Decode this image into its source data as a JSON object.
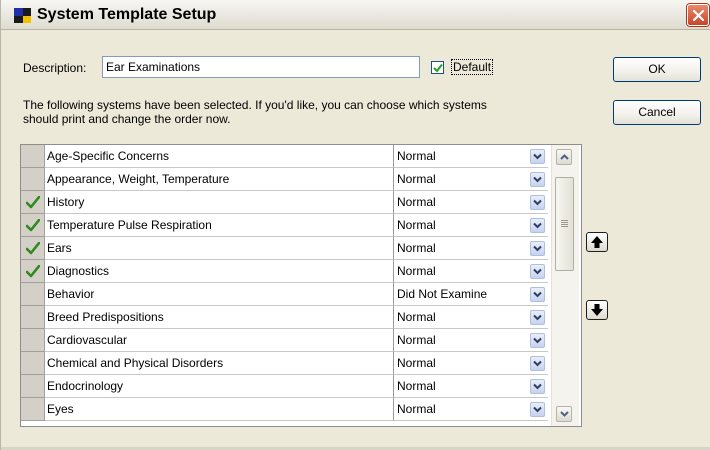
{
  "window": {
    "title": "System Template Setup"
  },
  "form": {
    "description_label": "Description:",
    "description_value": "Ear Examinations",
    "default_label": "Default",
    "default_checked": true
  },
  "buttons": {
    "ok": "OK",
    "cancel": "Cancel"
  },
  "info": {
    "line1": "The following systems have been selected.  If you'd like, you can choose which systems",
    "line2": "should print and change the order now."
  },
  "systems": [
    {
      "name": "Age-Specific Concerns",
      "status": "Normal",
      "checked": false
    },
    {
      "name": "Appearance, Weight, Temperature",
      "status": "Normal",
      "checked": false
    },
    {
      "name": "History",
      "status": "Normal",
      "checked": true
    },
    {
      "name": "Temperature Pulse Respiration",
      "status": "Normal",
      "checked": true
    },
    {
      "name": "Ears",
      "status": "Normal",
      "checked": true
    },
    {
      "name": "Diagnostics",
      "status": "Normal",
      "checked": true
    },
    {
      "name": "Behavior",
      "status": "Did Not Examine",
      "checked": false
    },
    {
      "name": "Breed Predispositions",
      "status": "Normal",
      "checked": false
    },
    {
      "name": "Cardiovascular",
      "status": "Normal",
      "checked": false
    },
    {
      "name": "Chemical and Physical Disorders",
      "status": "Normal",
      "checked": false
    },
    {
      "name": "Endocrinology",
      "status": "Normal",
      "checked": false
    },
    {
      "name": "Eyes",
      "status": "Normal",
      "checked": false
    }
  ],
  "icons": {
    "app": "app-icon",
    "close": "close-icon",
    "check": "checkmark-icon",
    "dropdown": "chevron-down-icon",
    "scroll_up": "scroll-up-icon",
    "scroll_down": "scroll-down-icon",
    "move_up": "move-up-arrow-icon",
    "move_down": "move-down-arrow-icon"
  },
  "colors": {
    "check_green": "#2f8a1f",
    "close_red": "#c8442a",
    "button_border": "#003c74"
  }
}
